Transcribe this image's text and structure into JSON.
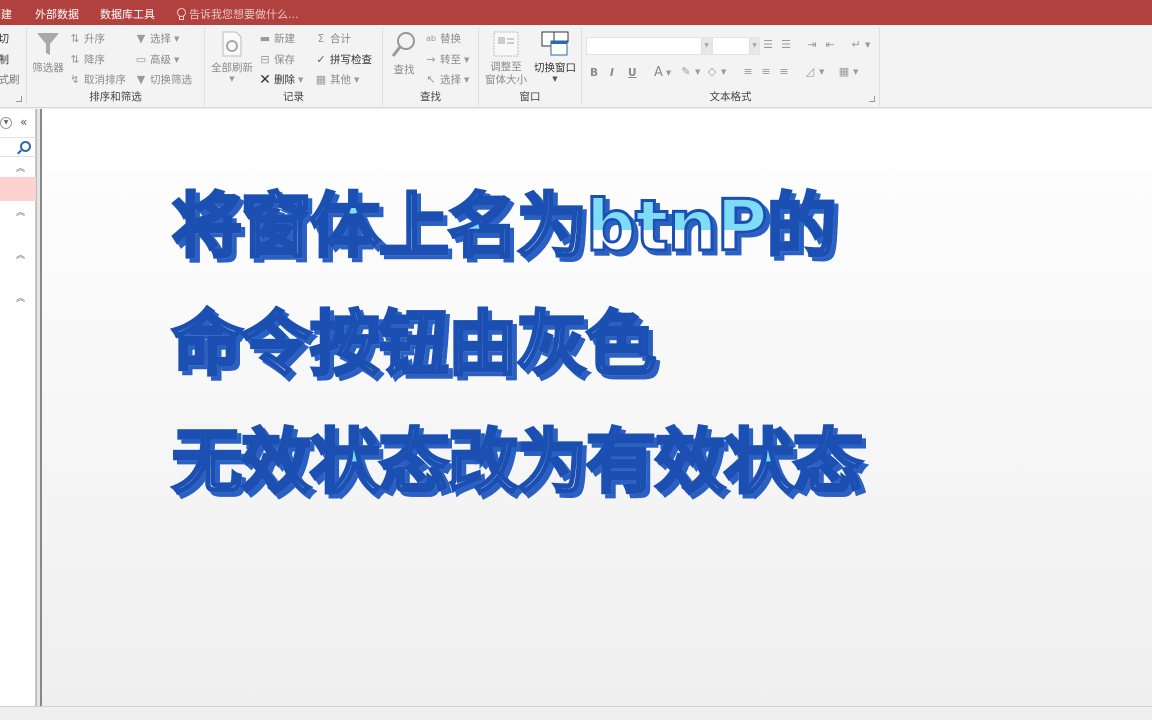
{
  "tabs": [
    {
      "label": "创建"
    },
    {
      "label": "外部数据"
    },
    {
      "label": "数据库工具"
    }
  ],
  "tell_me": "告诉我您想要做什么...",
  "ribbon": {
    "clipboard": {
      "items": [
        "剪切",
        "复制",
        "格式刷"
      ]
    },
    "sort_filter": {
      "label": "排序和筛选",
      "filter": "筛选器",
      "ascending": "升序",
      "descending": "降序",
      "remove_sort": "取消排序",
      "selection": "选择",
      "advanced": "高级",
      "toggle_filter": "切换筛选"
    },
    "records": {
      "label": "记录",
      "refresh_all": "全部刷新",
      "new": "新建",
      "save": "保存",
      "delete": "删除",
      "totals": "合计",
      "spelling": "拼写检查",
      "more": "其他"
    },
    "find": {
      "label": "查找",
      "find": "查找",
      "replace": "替换",
      "goto": "转至",
      "select": "选择"
    },
    "window": {
      "label": "窗口",
      "size_to_fit_1": "调整至",
      "size_to_fit_2": "窗体大小",
      "switch_windows": "切换窗口"
    },
    "text_format": {
      "label": "文本格式",
      "font_value": "",
      "size_value": "",
      "bold": "B",
      "italic": "I",
      "underline": "U",
      "font_color": "A"
    }
  },
  "caption": {
    "lines": [
      "将窗体上名为btnP的",
      "命令按钮由灰色",
      "无效状态改为有效状态"
    ]
  },
  "colors": {
    "accent": "#b0413e",
    "caption_fill_top": "#7fdcf6",
    "caption_fill_bottom": "#ffffff",
    "caption_stroke": "#1c4fb2",
    "nav_selected": "#fcd3d0"
  }
}
